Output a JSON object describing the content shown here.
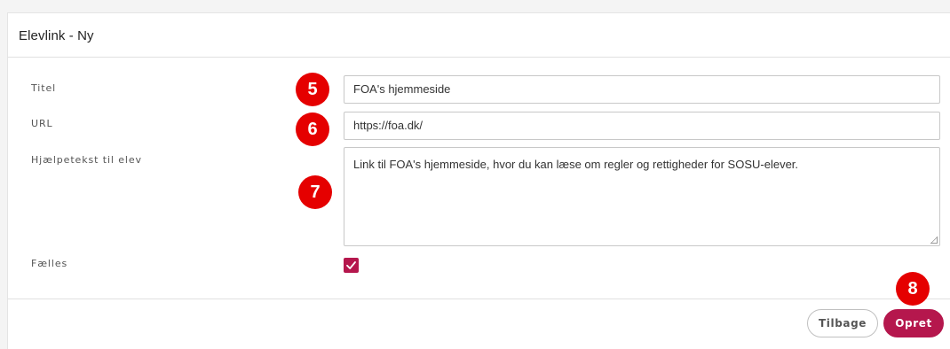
{
  "form": {
    "title": "Elevlink - Ny",
    "fields": {
      "titel": {
        "label": "Titel",
        "value": "FOA's hjemmeside"
      },
      "url": {
        "label": "URL",
        "value": "https://foa.dk/"
      },
      "hjaelpetekst": {
        "label": "Hjælpetekst til elev",
        "value": "Link til FOA's hjemmeside, hvor du kan læse om regler og rettigheder for SOSU-elever."
      },
      "faelles": {
        "label": "Fælles",
        "checked": true
      }
    },
    "buttons": {
      "back_label": "Tilbage",
      "create_label": "Opret"
    }
  },
  "annotations": {
    "step5": "5",
    "step6": "6",
    "step7": "7",
    "step8": "8"
  },
  "colors": {
    "accent": "#b5174d",
    "badge": "#e50000"
  }
}
